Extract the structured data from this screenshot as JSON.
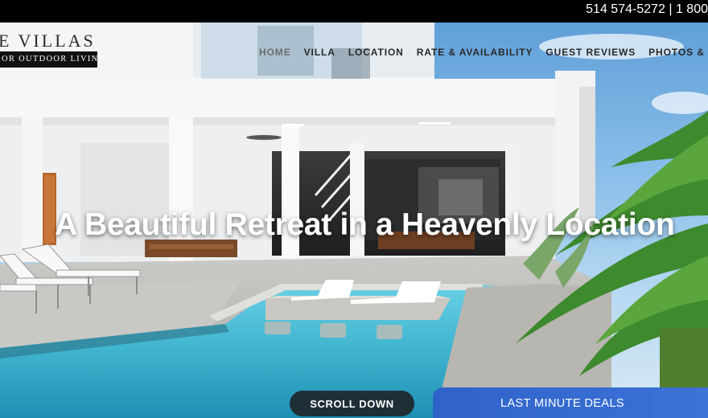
{
  "topbar": {
    "phone": "514 574-5272 | 1 800"
  },
  "logo": {
    "name": "E VILLAS",
    "tagline": "OR OUTDOOR LIVING"
  },
  "nav": {
    "items": [
      {
        "label": "HOME"
      },
      {
        "label": "VILLA"
      },
      {
        "label": "LOCATION"
      },
      {
        "label": "RATE & AVAILABILITY"
      },
      {
        "label": "GUEST REVIEWS"
      },
      {
        "label": "PHOTOS & VIDEOS"
      }
    ]
  },
  "hero": {
    "headline": "A Beautiful Retreat in a Heavenly Location",
    "scroll_label": "SCROLL DOWN",
    "deals_label": "LAST MINUTE DEALS"
  },
  "colors": {
    "topbar": "#000000",
    "pool": "#3fb4cf",
    "villa_wall": "#f2f3f4",
    "scroll_button": "#1f2f38",
    "deals_button": "#3468d0"
  }
}
